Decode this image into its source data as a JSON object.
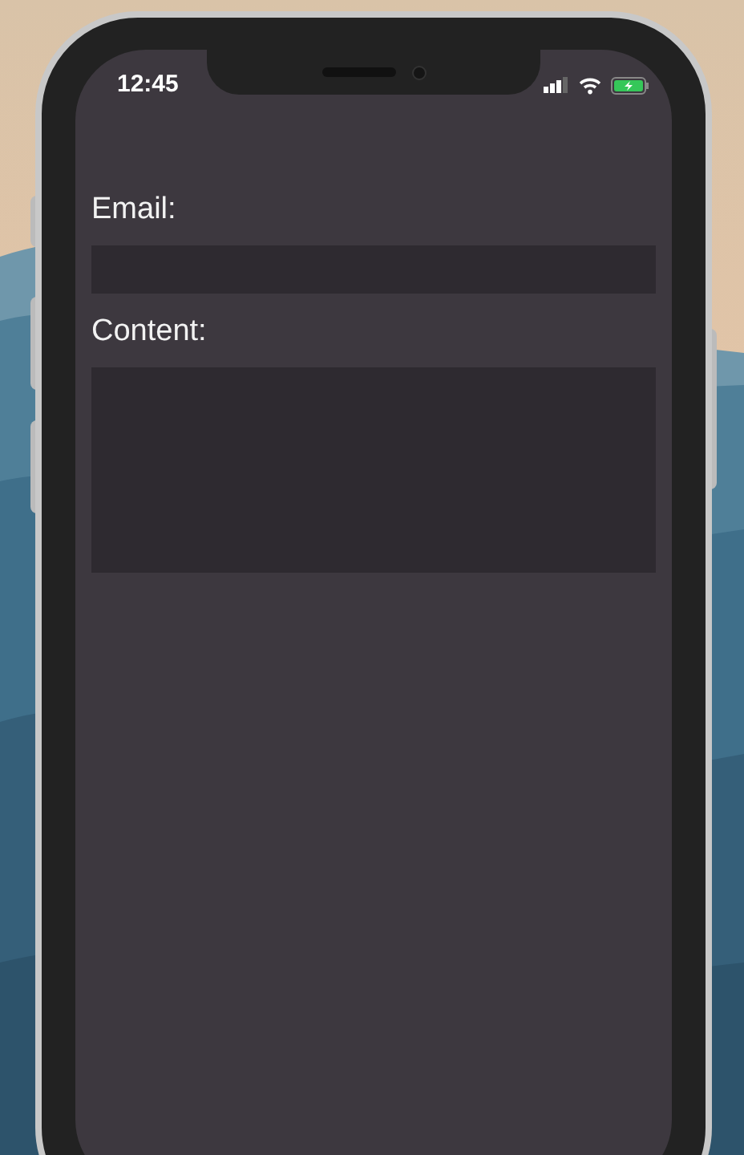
{
  "status_bar": {
    "time": "12:45"
  },
  "form": {
    "fields": [
      {
        "label": "Email:",
        "kind": "input"
      },
      {
        "label": "Content:",
        "kind": "textarea"
      }
    ]
  }
}
